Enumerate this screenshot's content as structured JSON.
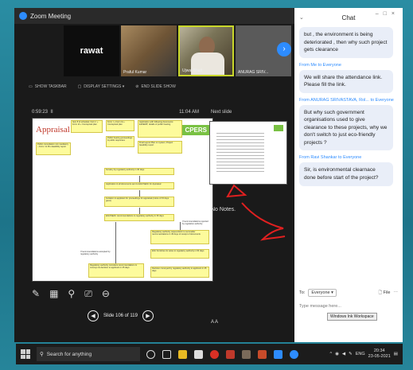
{
  "window": {
    "title": "Zoom Meeting"
  },
  "participants": [
    {
      "label": "rawat"
    },
    {
      "label": "Praful Kumar"
    },
    {
      "label": "Ujwal Bhatt"
    },
    {
      "label": "ANURAG SRIV..."
    }
  ],
  "toolbar": {
    "show_taskbar": "SHOW TASKBAR",
    "display_settings": "DISPLAY SETTINGS ▾",
    "end_slide_show": "END SLIDE SHOW"
  },
  "presenter": {
    "elapsed": "0:59:23",
    "pause_icon": "II",
    "clock": "11:04 AM",
    "next_slide_label": "Next slide",
    "notes": "No Notes.",
    "slide_counter": "Slide 106 of 119",
    "font_toggle": "A  A"
  },
  "slide": {
    "title": "Appraisal",
    "badge": "CPERS",
    "boxes": [
      "Item 8 of schedule: Form I + Form IA + Conceptual plan",
      "Form I + Form IA + Conceptual plan",
      "Application with following documents: EIA/EMP; details of public hearing",
      "Public consultation not mandatory – Form I & Pre-feasibility report",
      "Public hearing proceedings & public responses",
      "Final Layout Plan on system; Project feasibility report",
      "Scrutiny by regulatory authority in 30 days",
      "Application & all documents sent to EAC/SEAC for Appraisal",
      "Invitation to applicant for proceedings for appraisal (notice of 15 days given)",
      "EAC/SEAC recommendations to regulatory authority in 60 days",
      "Regulatory authority request EAC to reconsider recommendations in 45 days of receipt of documents",
      "EAC furnishes its views to regulatory authority in 60 days",
      "Regulatory authority considers recommendations & conveys its decision to applicant in 45 days",
      "Decision conveyed by regulatory authority to applicant in 45 days"
    ],
    "side_notes": [
      "If recommendations rejected by regulation authority",
      "If recommendations accepted by regulatory authority"
    ]
  },
  "chat": {
    "title": "Chat",
    "messages": [
      {
        "from": "",
        "to": "",
        "text": "but , the environment is being deteriorated , then why such project gets clearance"
      },
      {
        "from": "Me",
        "to": "Everyone",
        "text": "We will share the attendance link. Please fill the link."
      },
      {
        "from": "ANURAG SRIVASTAVA, Rol...",
        "to": "Everyone",
        "text": "But why such government organisations used to give clearance to these projects, why we don't switch to just eco-friendly projects ?"
      },
      {
        "from": "Ravi Shankar",
        "to": "Everyone",
        "text": "Sir, is environmental clearnace done before start of the project?"
      }
    ],
    "from_prefix": "From",
    "to_word": "to",
    "to_label": "To:",
    "to_value": "Everyone ▾",
    "file_label": "File",
    "input_placeholder": "Type message here..."
  },
  "tooltip": "Windows Ink Workspace",
  "taskbar": {
    "search_placeholder": "Search for anything",
    "lang": "ENG",
    "time": "20:34",
    "date": "23-05-2021"
  }
}
